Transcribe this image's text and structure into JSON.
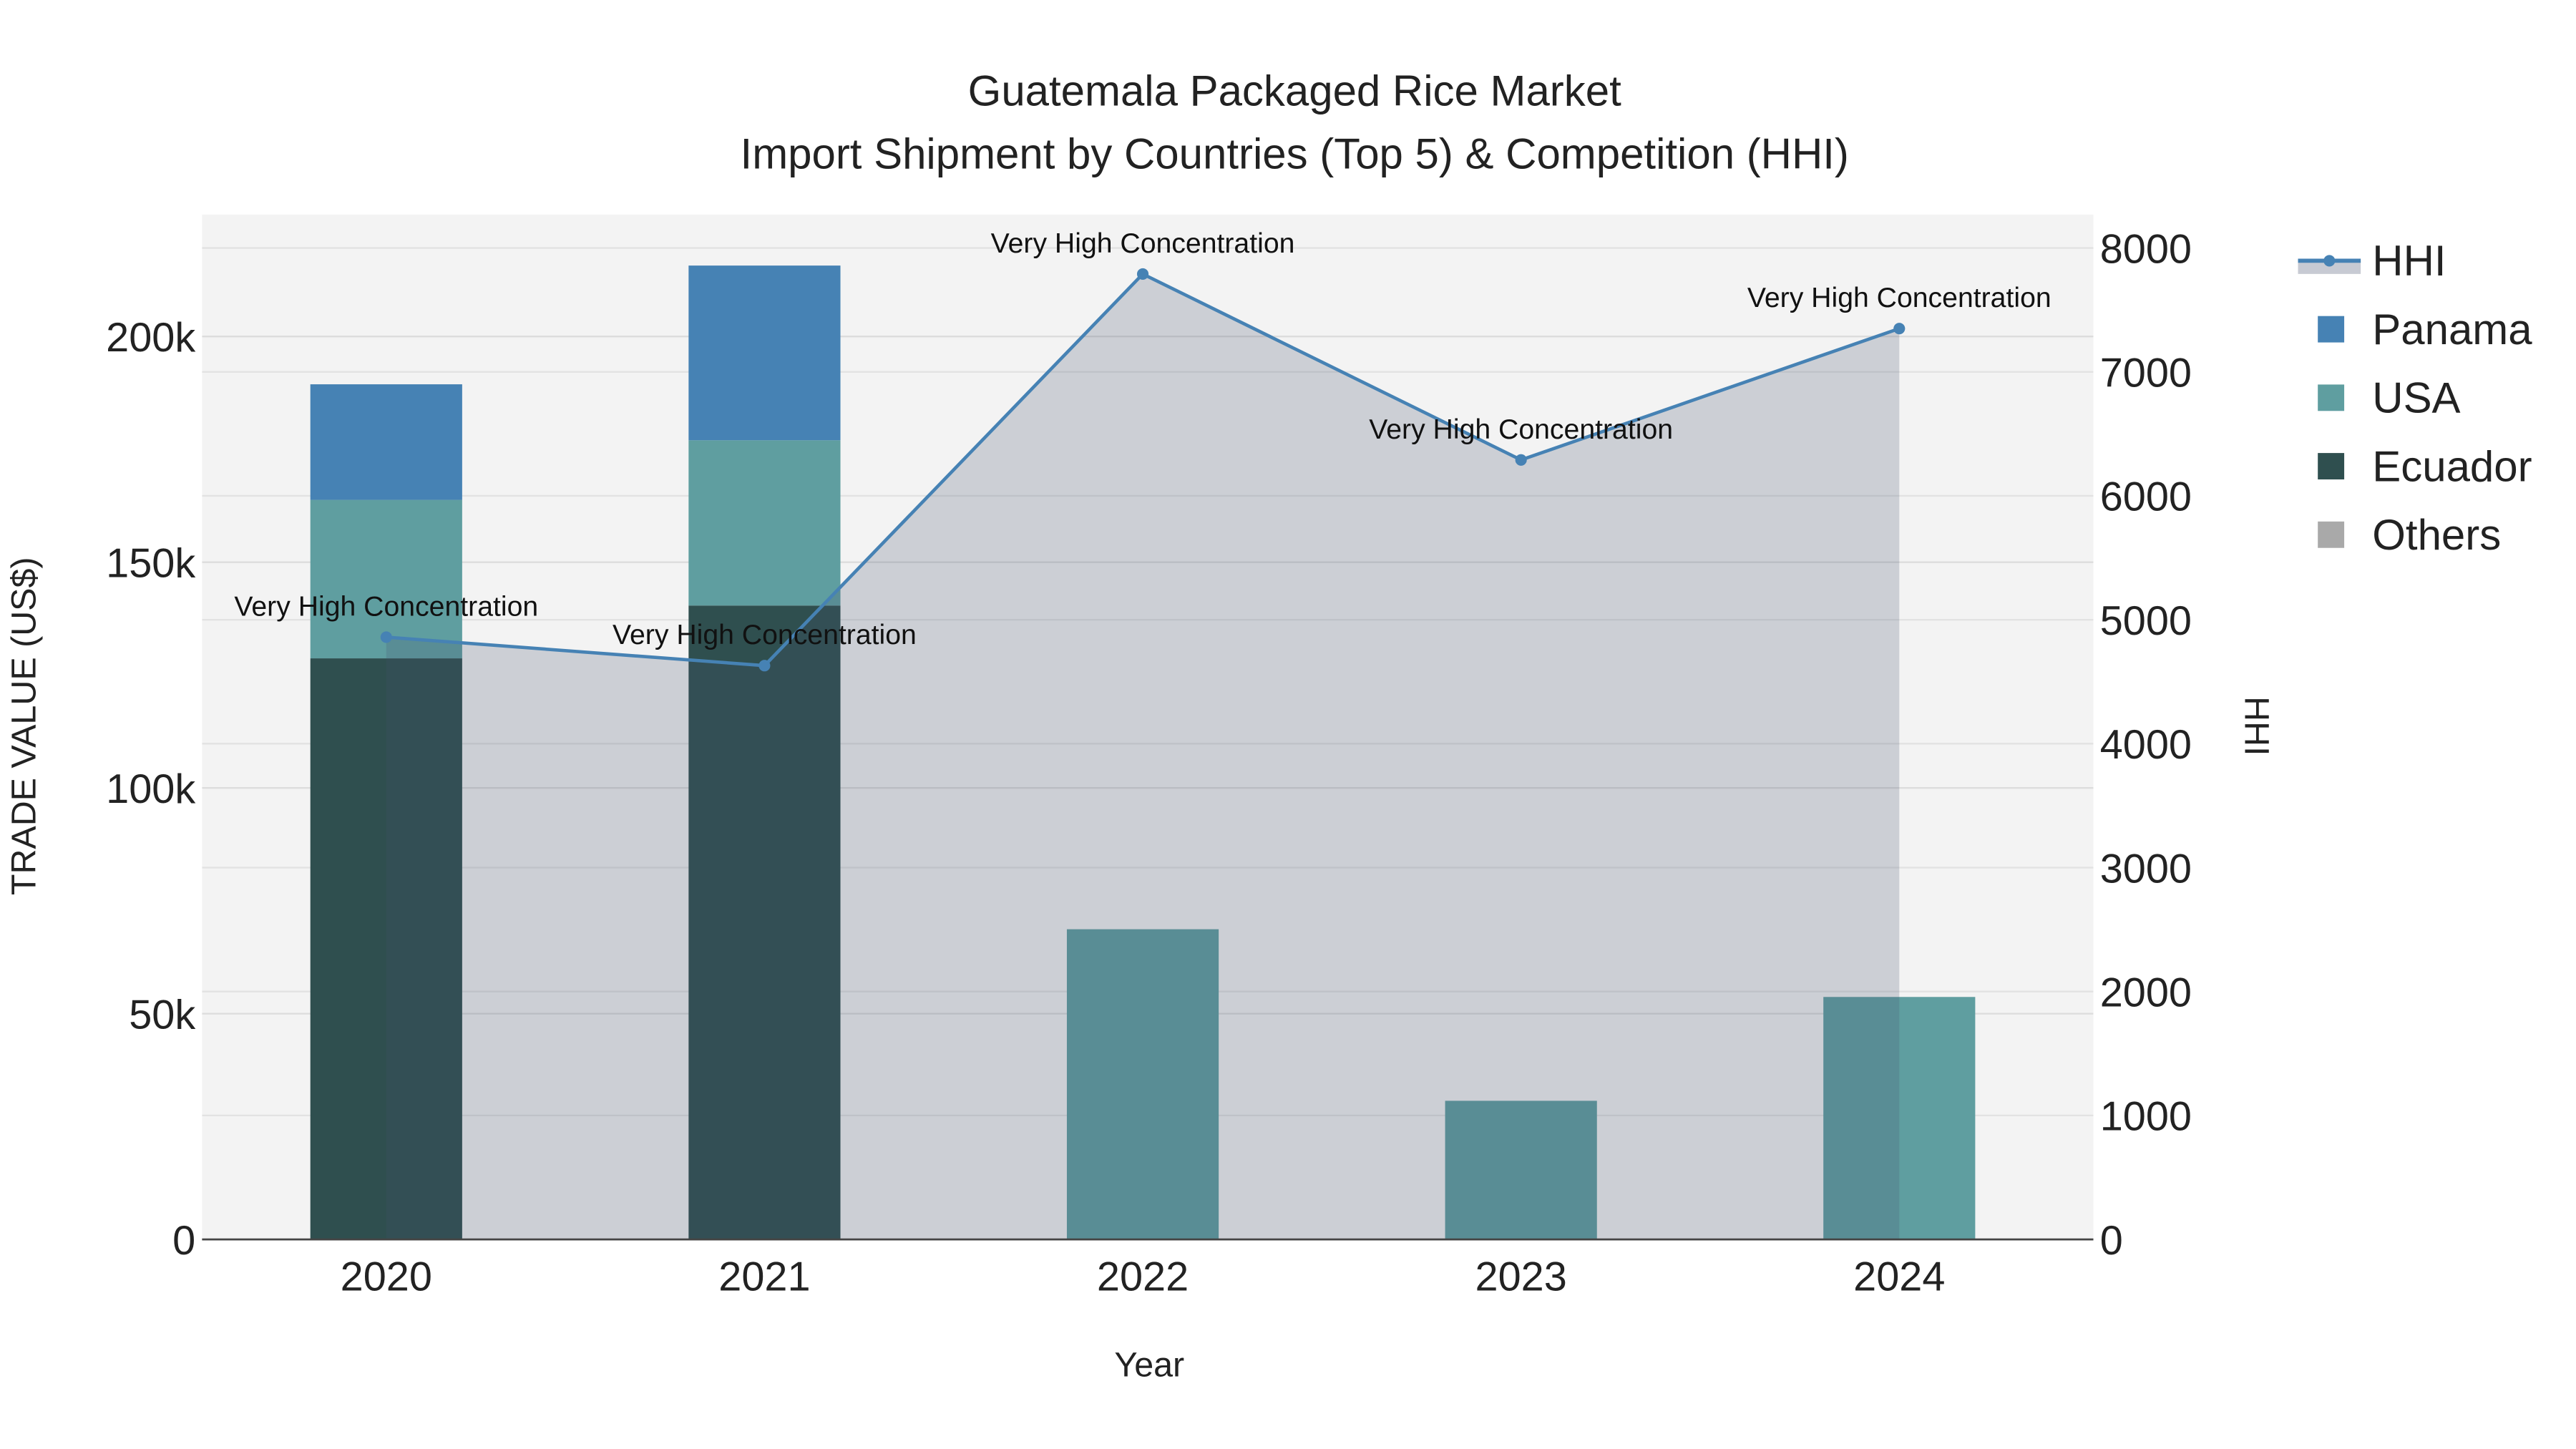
{
  "chart_data": {
    "type": "bar",
    "title_line1": "Guatemala Packaged Rice Market",
    "title_line2": "Import Shipment by Countries (Top 5) & Competition (HHI)",
    "xlabel": "Year",
    "ylabel": "TRADE VALUE (US$)",
    "y2label": "HHI",
    "categories": [
      "2020",
      "2021",
      "2022",
      "2023",
      "2024"
    ],
    "ylim": [
      0,
      227000
    ],
    "y_ticks": [
      0,
      50000,
      100000,
      150000,
      200000
    ],
    "y_tick_labels": [
      "0",
      "50k",
      "100k",
      "150k",
      "200k"
    ],
    "y2lim": [
      0,
      8270
    ],
    "y2_ticks": [
      0,
      1000,
      2000,
      3000,
      4000,
      5000,
      6000,
      7000,
      8000
    ],
    "y2_tick_labels": [
      "0",
      "1000",
      "2000",
      "3000",
      "4000",
      "5000",
      "6000",
      "7000",
      "8000"
    ],
    "grid": true,
    "legend_position": "right",
    "stacked_series": [
      {
        "name": "Ecuador",
        "color": "#2f4f4f",
        "values": [
          128700,
          140400,
          0,
          0,
          0
        ]
      },
      {
        "name": "USA",
        "color": "#5f9ea0",
        "values": [
          35100,
          36600,
          68700,
          30700,
          53700
        ]
      },
      {
        "name": "Panama",
        "color": "#4682b4",
        "values": [
          25600,
          38700,
          0,
          0,
          0
        ]
      },
      {
        "name": "Others",
        "color": "#a9a9a9",
        "values": [
          0,
          0,
          0,
          0,
          0
        ]
      }
    ],
    "line_series": {
      "name": "HHI",
      "color": "#4682b4",
      "values": [
        4860,
        4630,
        7790,
        6290,
        7350
      ],
      "annotations": [
        "Very High Concentration",
        "Very High Concentration",
        "Very High Concentration",
        "Very High Concentration",
        "Very High Concentration"
      ]
    },
    "legend": [
      "HHI",
      "Panama",
      "USA",
      "Ecuador",
      "Others"
    ]
  }
}
